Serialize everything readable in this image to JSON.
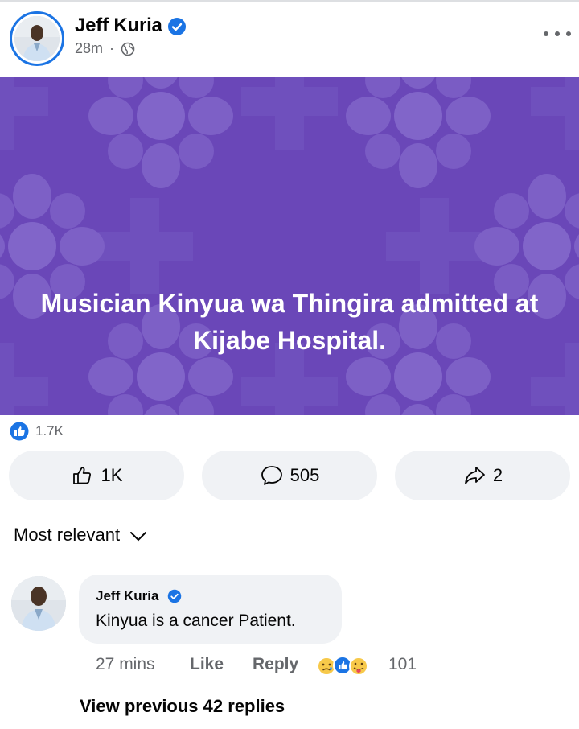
{
  "post": {
    "author": "Jeff Kuria",
    "time": "28m",
    "separator": "·",
    "banner_text": "Musician Kinyua wa Thingira admitted at Kijabe Hospital.",
    "banner_color": "#6a47b8",
    "reaction_count": "1.7K",
    "actions": {
      "like_count": "1K",
      "comment_count": "505",
      "share_count": "2"
    }
  },
  "comments": {
    "sort_label": "Most relevant",
    "items": [
      {
        "author": "Jeff Kuria",
        "text": "Kinyua is a cancer Patient.",
        "time": "27 mins",
        "like_label": "Like",
        "reply_label": "Reply",
        "reaction_count": "101"
      }
    ],
    "view_previous": "View previous 42 replies"
  },
  "icons": {
    "verified": "verified-badge-icon",
    "globe": "globe-icon",
    "more": "more-options-icon",
    "like": "thumbs-up-icon",
    "comment": "comment-bubble-icon",
    "share": "share-arrow-icon",
    "chevron": "chevron-down-icon"
  },
  "colors": {
    "accent": "#1b74e4",
    "secondary_text": "#65676b",
    "button_bg": "#f0f2f5"
  }
}
